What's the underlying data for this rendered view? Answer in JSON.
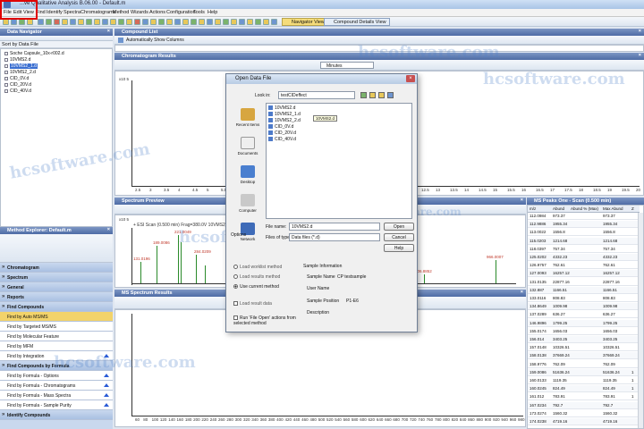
{
  "app": {
    "title": "...ve Qualitative Analysis B.06.00 - Default.m"
  },
  "menu": [
    "File",
    "Edit",
    "View",
    "Find",
    "Identify",
    "Spectra",
    "Chromatograms",
    "Method",
    "Wizards",
    "Actions",
    "Configuration",
    "Tools",
    "Help"
  ],
  "toolbar": {
    "navigator_view": "Navigator View",
    "compound_details_view": "Compound Details View"
  },
  "data_navigator": {
    "title": "Data Navigator",
    "sort_label": "Sort by Data File",
    "items": [
      "Soche Capsule_10x-r002.d",
      "10VMS2.d",
      "10VMS2_1.d",
      "10VMS2_2.d",
      "CID_0V.d",
      "CID_20V.d",
      "CID_40V.d"
    ]
  },
  "compound_list": {
    "title": "Compound List",
    "auto_show_columns": "Automatically Show Columns"
  },
  "chromatogram": {
    "title": "Chromatogram Results",
    "units": "Minutes",
    "y_exp": "x10 5",
    "x_ticks": [
      "2.5",
      "3",
      "3.5",
      "4",
      "4.5",
      "5",
      "5.5",
      "6",
      "6.5",
      "7",
      "7.5",
      "8",
      "8.5",
      "9",
      "9.5",
      "10",
      "10.5",
      "11",
      "11.5",
      "12",
      "12.5",
      "13",
      "13.5",
      "14",
      "14.5",
      "15",
      "15.5",
      "16",
      "16.5",
      "17",
      "17.5",
      "18",
      "18.5",
      "19",
      "19.5",
      "20"
    ]
  },
  "spectrum_preview": {
    "title": "Spectrum Preview",
    "header": "+ ESI Scan (0.500 min) Frag=380.0V 10VMS2_1.d",
    "y_exp": "x10 5",
    "peaks": [
      "131.0196",
      "189.0086",
      "221.0049",
      "284.0209",
      "806.8852",
      "966.0007"
    ]
  },
  "ms_spectrum": {
    "title": "MS Spectrum Results",
    "x_ticks": [
      "60",
      "80",
      "100",
      "120",
      "140",
      "160",
      "180",
      "200",
      "220",
      "240",
      "260",
      "280",
      "300",
      "320",
      "340",
      "360",
      "380",
      "400",
      "420",
      "440",
      "460",
      "480",
      "500",
      "520",
      "540",
      "560",
      "580",
      "600",
      "620",
      "640",
      "660",
      "680",
      "700",
      "720",
      "740",
      "760",
      "780",
      "800",
      "820",
      "840",
      "860",
      "880",
      "900",
      "920",
      "940",
      "960",
      "980"
    ]
  },
  "method_explorer": {
    "title": "Method Explorer: Default.m",
    "sections": [
      "Chromatogram",
      "Spectrum",
      "General",
      "Reports",
      "Find Compounds"
    ],
    "find_items": [
      "Find by Auto MS/MS",
      "Find by Targeted MS/MS",
      "Find by Molecular Feature",
      "Find by MFM",
      "Find by Integration"
    ],
    "formula_section": "Find Compounds by Formula",
    "formula_items": [
      "Find by Formula - Options",
      "Find by Formula - Chromatograms",
      "Find by Formula - Mass Spectra",
      "Find by Formula - Sample Purity"
    ],
    "identify_section": "Identify Compounds"
  },
  "ms_peaks": {
    "title": "MS Peaks One - Scan (0.500 min)",
    "columns": [
      "m/z",
      "Abund",
      "Abund % (Max)",
      "Max Abund",
      "Z"
    ],
    "rows": [
      [
        "112.0984",
        "973.37",
        "",
        "973.37",
        ""
      ],
      [
        "112.9886",
        "1955.34",
        "",
        "1955.34",
        ""
      ],
      [
        "113.0022",
        "1556.8",
        "",
        "1556.8",
        ""
      ],
      [
        "115.0203",
        "1214.68",
        "",
        "1214.68",
        ""
      ],
      [
        "118.0397",
        "757.34",
        "",
        "757.34",
        ""
      ],
      [
        "125.0202",
        "4332.23",
        "",
        "4332.23",
        ""
      ],
      [
        "126.9757",
        "762.61",
        "",
        "762.61",
        ""
      ],
      [
        "127.0093",
        "16257.12",
        "",
        "16257.12",
        ""
      ],
      [
        "131.0135",
        "22877.16",
        "",
        "22877.16",
        ""
      ],
      [
        "132.887",
        "1166.51",
        "",
        "1166.51",
        ""
      ],
      [
        "133.0116",
        "808.83",
        "",
        "808.83",
        ""
      ],
      [
        "134.8649",
        "1009.98",
        "",
        "1009.98",
        ""
      ],
      [
        "137.0289",
        "636.27",
        "",
        "636.27",
        ""
      ],
      [
        "146.9896",
        "1799.25",
        "",
        "1799.25",
        ""
      ],
      [
        "155.0174",
        "1656.03",
        "",
        "1656.03",
        ""
      ],
      [
        "156.014",
        "3403.25",
        "",
        "3403.25",
        ""
      ],
      [
        "157.0148",
        "10326.51",
        "",
        "10326.51",
        ""
      ],
      [
        "158.0138",
        "37669.24",
        "",
        "37669.24",
        ""
      ],
      [
        "158.9776",
        "762.09",
        "",
        "762.09",
        ""
      ],
      [
        "159.0086",
        "51636.24",
        "",
        "51636.24",
        "1"
      ],
      [
        "160.0133",
        "1119.35",
        "",
        "1119.35",
        "1"
      ],
      [
        "160.0245",
        "824.49",
        "",
        "824.49",
        "1"
      ],
      [
        "161.012",
        "783.91",
        "",
        "783.91",
        "1"
      ],
      [
        "167.0234",
        "792.7",
        "",
        "792.7",
        ""
      ],
      [
        "173.0274",
        "1560.32",
        "",
        "1560.32",
        ""
      ],
      [
        "174.0238",
        "4719.16",
        "",
        "4719.16",
        ""
      ]
    ]
  },
  "open_dialog": {
    "title": "Open Data File",
    "look_in_label": "Look in:",
    "look_in_value": "testCIDeffect",
    "places": [
      "Recent Items",
      "Documents",
      "Desktop",
      "Computer",
      "Network"
    ],
    "files": [
      "10VMS2.d",
      "10VMS2_1.d",
      "10VMS2_2.d",
      "CID_0V.d",
      "CID_20V.d",
      "CID_40V.d"
    ],
    "tooltip": "10VMS2.d",
    "file_name_label": "File name:",
    "file_name_value": "10VMS2.d",
    "files_of_type_label": "Files of type:",
    "files_of_type_value": "Data files (*.d)",
    "open_button": "Open",
    "cancel_button": "Cancel",
    "help_button": "Help",
    "options_label": "Options",
    "radio_worklist": "Load worklist method",
    "radio_results": "Load results method",
    "radio_current": "Use current method",
    "load_result_data": "Load result data",
    "run_actions": "Run 'File Open' actions from selected method",
    "sample_info_label": "Sample Information",
    "sample_name_label": "Sample Name",
    "sample_name_value": "CP testsample",
    "user_name_label": "User Name",
    "sample_position_label": "Sample Position",
    "sample_position_value": "P1-E6",
    "description_label": "Description"
  },
  "watermark": "hcsoftware.com"
}
